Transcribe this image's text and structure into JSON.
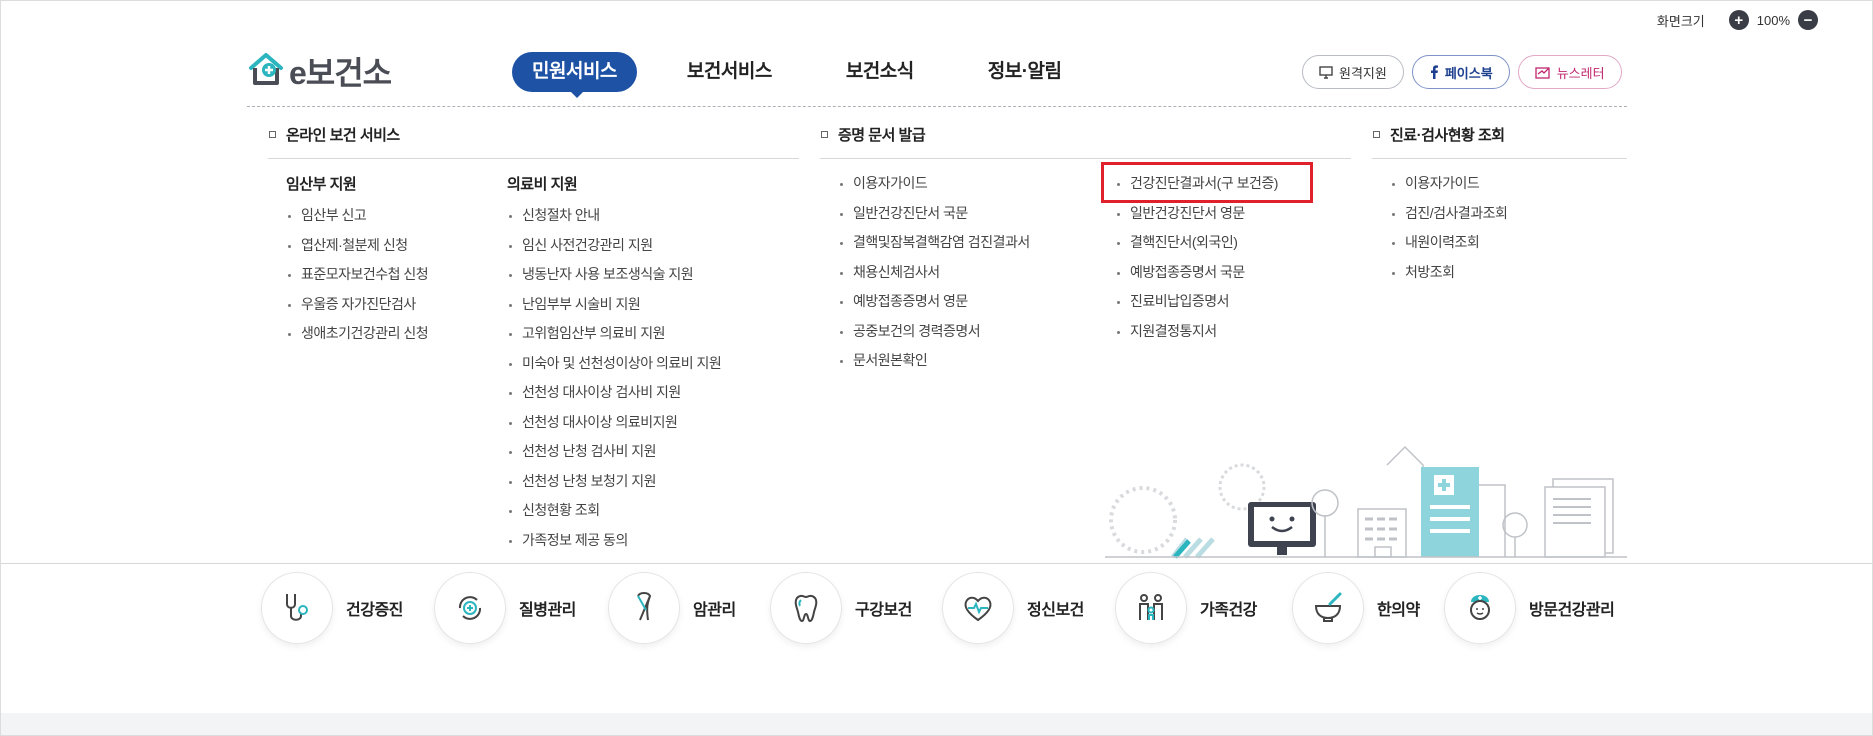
{
  "top_util": {
    "label": "화면크기",
    "zoom_in": "+",
    "zoom_value": "100%",
    "zoom_out": "−"
  },
  "logo": {
    "e": "e",
    "text": "보건소"
  },
  "gnb": [
    {
      "label": "민원서비스"
    },
    {
      "label": "보건서비스"
    },
    {
      "label": "보건소식"
    },
    {
      "label": "정보·알림"
    }
  ],
  "sns": {
    "remote": "원격지원",
    "facebook": "페이스북",
    "newsletter": "뉴스레터"
  },
  "sections": {
    "online": {
      "title": "온라인 보건 서비스",
      "col1": {
        "head": "임산부 지원",
        "items": [
          "임산부 신고",
          "엽산제·철분제 신청",
          "표준모자보건수첩 신청",
          "우울증 자가진단검사",
          "생애초기건강관리 신청"
        ]
      },
      "col2": {
        "head": "의료비 지원",
        "items": [
          "신청절차 안내",
          "임신 사전건강관리 지원",
          "냉동난자 사용 보조생식술 지원",
          "난임부부 시술비 지원",
          "고위험임산부 의료비 지원",
          "미숙아 및 선천성이상아 의료비 지원",
          "선천성 대사이상 검사비 지원",
          "선천성 대사이상 의료비지원",
          "선천성 난청 검사비 지원",
          "선천성 난청 보청기 지원",
          "신청현황 조회",
          "가족정보 제공 동의"
        ]
      }
    },
    "cert": {
      "title": "증명 문서 발급",
      "col1": {
        "items": [
          "이용자가이드",
          "일반건강진단서 국문",
          "결핵및잠복결핵감염 검진결과서",
          "채용신체검사서",
          "예방접종증명서 영문",
          "공중보건의 경력증명서",
          "문서원본확인"
        ]
      },
      "col2": {
        "items": [
          "건강진단결과서(구 보건증)",
          "일반건강진단서 영문",
          "결핵진단서(외국인)",
          "예방접종증명서 국문",
          "진료비납입증명서",
          "지원결정통지서"
        ]
      }
    },
    "clinic": {
      "title": "진료·검사현황 조회",
      "col1": {
        "items": [
          "이용자가이드",
          "검진/검사결과조회",
          "내원이력조회",
          "처방조회"
        ]
      }
    }
  },
  "quick": [
    {
      "label": "건강증진",
      "icon": "stethoscope-icon"
    },
    {
      "label": "질병관리",
      "icon": "disease-care-icon"
    },
    {
      "label": "암관리",
      "icon": "ribbon-icon"
    },
    {
      "label": "구강보건",
      "icon": "tooth-icon"
    },
    {
      "label": "정신보건",
      "icon": "heart-pulse-icon"
    },
    {
      "label": "가족건강",
      "icon": "family-icon"
    },
    {
      "label": "한의약",
      "icon": "mortar-icon"
    },
    {
      "label": "방문건강관리",
      "icon": "nurse-icon"
    }
  ],
  "colors": {
    "brand_blue": "#1d52a5",
    "teal": "#2bb5bf",
    "highlight_red": "#e0202a"
  }
}
